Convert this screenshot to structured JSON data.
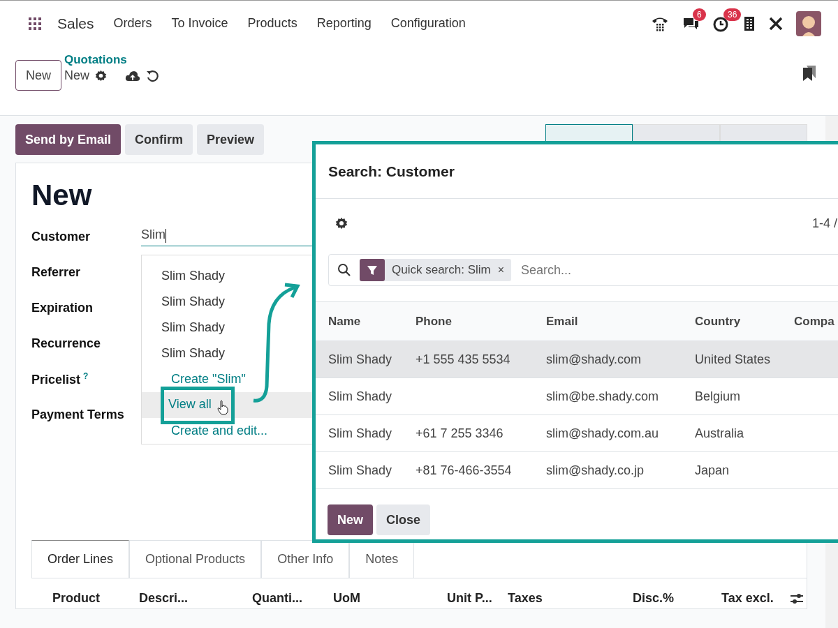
{
  "navbar": {
    "app": "Sales",
    "menu": [
      "Orders",
      "To Invoice",
      "Products",
      "Reporting",
      "Configuration"
    ],
    "badges": [
      {
        "kind": "chat",
        "count": "6"
      },
      {
        "kind": "activity",
        "count": "36"
      }
    ]
  },
  "breadcrumb": {
    "new_button": "New",
    "parent": "Quotations",
    "current": "New"
  },
  "actions": [
    {
      "label": "Send by Email",
      "primary": true
    },
    {
      "label": "Confirm",
      "primary": false
    },
    {
      "label": "Preview",
      "primary": false
    }
  ],
  "status_steps": [
    {
      "selected": true
    },
    {
      "selected": false
    },
    {
      "selected": false
    }
  ],
  "form": {
    "title": "New",
    "fields": [
      {
        "label": "Customer",
        "value": "Slim"
      },
      {
        "label": "Referrer"
      },
      {
        "label": "Expiration"
      },
      {
        "label": "Recurrence"
      },
      {
        "label": "Pricelist",
        "help": "?"
      },
      {
        "label": "Payment Terms"
      }
    ]
  },
  "dropdown": {
    "items": [
      {
        "label": "Slim Shady",
        "kind": "record",
        "selected": false
      },
      {
        "label": "Slim Shady",
        "kind": "record",
        "selected": false
      },
      {
        "label": "Slim Shady",
        "kind": "record",
        "selected": false
      },
      {
        "label": "Slim Shady",
        "kind": "record",
        "selected": false
      },
      {
        "label": "Create \"Slim\"",
        "kind": "action",
        "selected": false
      },
      {
        "label": "View all",
        "kind": "action",
        "selected": true
      },
      {
        "label": "Create and edit...",
        "kind": "action",
        "selected": false
      }
    ]
  },
  "dialog": {
    "title": "Search: Customer",
    "pager": "1-4 /",
    "facet": {
      "label": "Quick search: Slim",
      "remove": "×"
    },
    "search_placeholder": "Search...",
    "columns": [
      "Name",
      "Phone",
      "Email",
      "Country",
      "Compa"
    ],
    "rows": [
      {
        "cells": [
          "Slim Shady",
          "+1 555 435 5534",
          "slim@shady.com",
          "United States"
        ],
        "selected": true
      },
      {
        "cells": [
          "Slim Shady",
          "",
          "slim@be.shady.com",
          "Belgium"
        ],
        "selected": false
      },
      {
        "cells": [
          "Slim Shady",
          "+61 7 255 3346",
          "slim@shady.com.au",
          "Australia"
        ],
        "selected": false
      },
      {
        "cells": [
          "Slim Shady",
          "+81 76-466-3554",
          "slim@shady.co.jp",
          "Japan"
        ],
        "selected": false
      }
    ],
    "buttons": [
      {
        "label": "New",
        "primary": true
      },
      {
        "label": "Close",
        "primary": false
      }
    ]
  },
  "tabs": [
    {
      "label": "Order Lines",
      "selected": true
    },
    {
      "label": "Optional Products",
      "selected": false
    },
    {
      "label": "Other Info",
      "selected": false
    },
    {
      "label": "Notes",
      "selected": false
    }
  ],
  "lines_columns": [
    "Product",
    "Descri...",
    "Quanti...",
    "UoM",
    "Unit P...",
    "Taxes",
    "Disc.%",
    "Tax excl."
  ]
}
